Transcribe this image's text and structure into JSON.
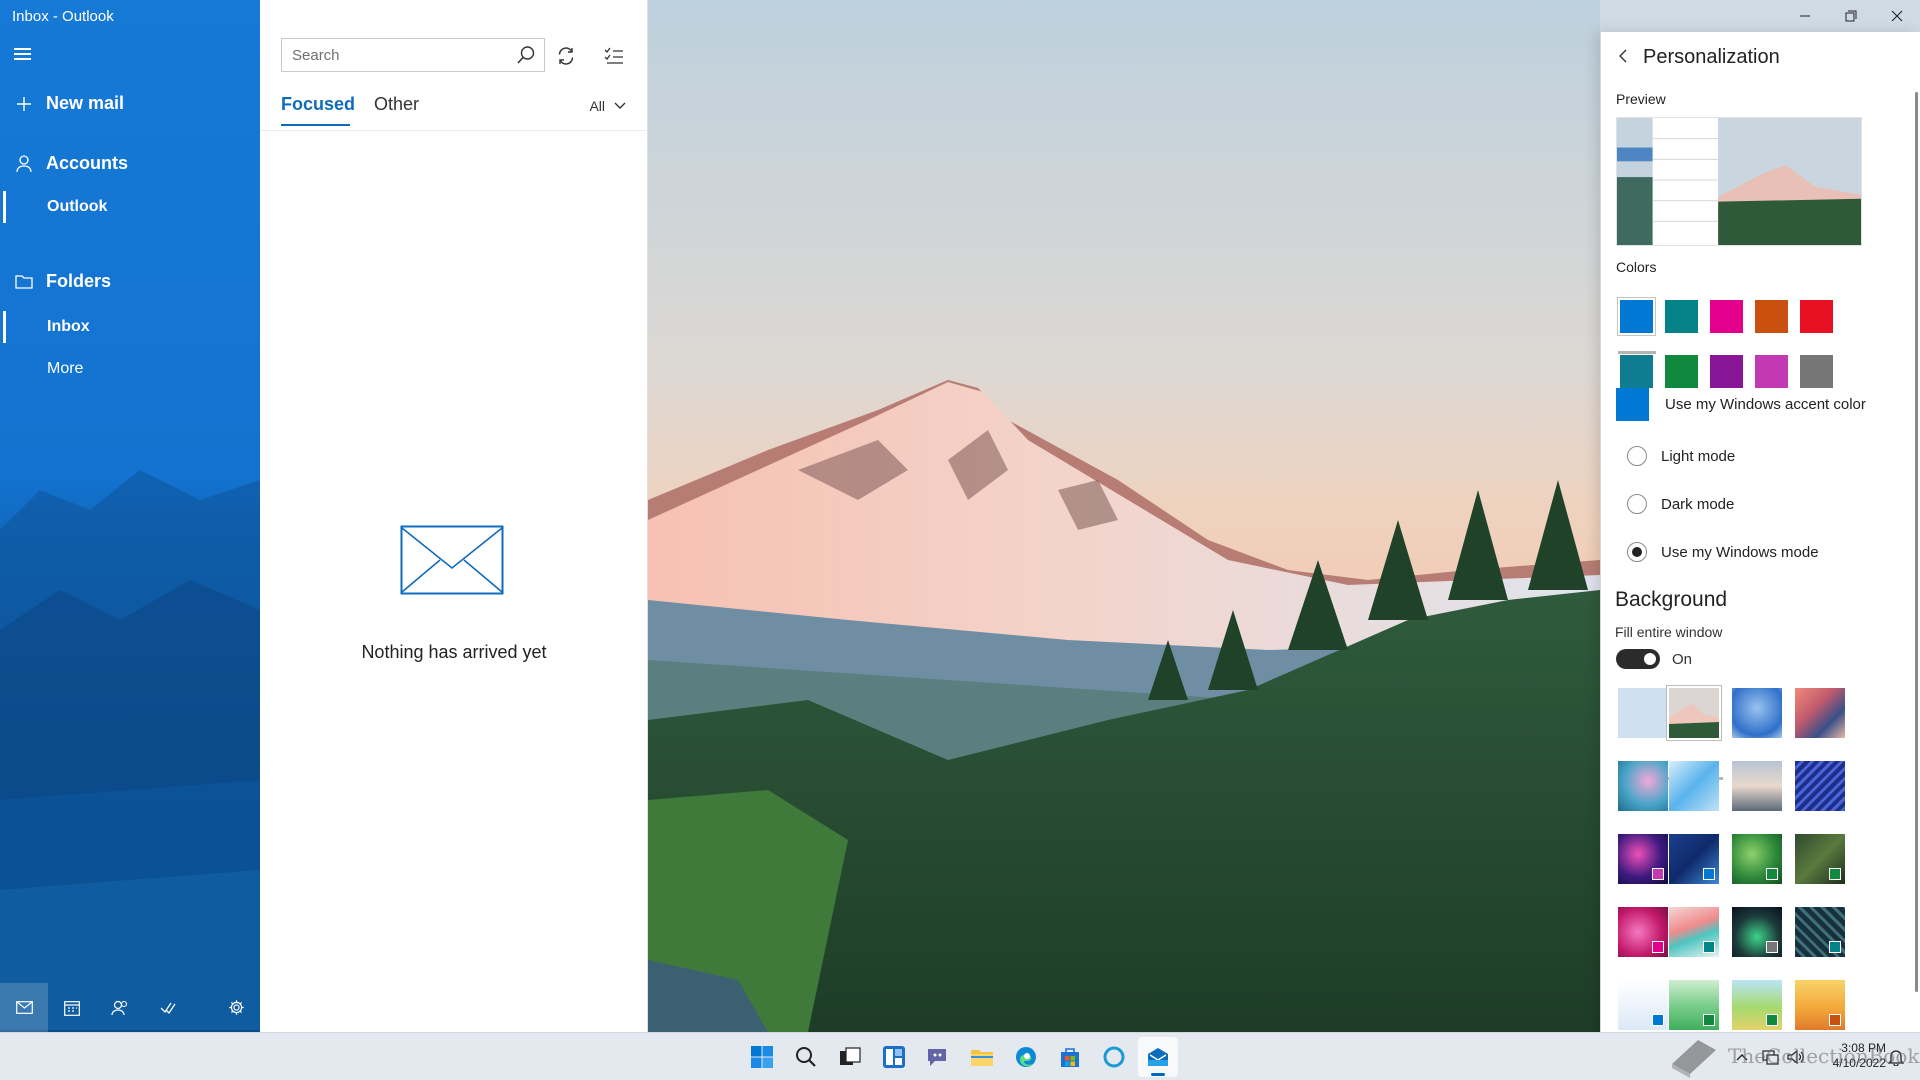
{
  "window": {
    "title": "Inbox - Outlook"
  },
  "nav": {
    "new_mail": "New mail",
    "accounts": "Accounts",
    "account_name": "Outlook",
    "folders": "Folders",
    "inbox": "Inbox",
    "more": "More",
    "bottom_icons": [
      "mail-icon",
      "calendar-icon",
      "people-icon",
      "todo-icon",
      "settings-icon"
    ]
  },
  "list": {
    "search_placeholder": "Search",
    "tabs": {
      "focused": "Focused",
      "other": "Other"
    },
    "filter": "All",
    "empty_message": "Nothing has arrived yet"
  },
  "personalization": {
    "title": "Personalization",
    "preview_label": "Preview",
    "colors_label": "Colors",
    "colors_row1": [
      "#0078d4",
      "#038387",
      "#e3008c",
      "#ca5010",
      "#e81123"
    ],
    "colors_row2": [
      "#0f7d91",
      "#10893e",
      "#881798",
      "#c239b3",
      "#767676"
    ],
    "selected_color": "#0078d4",
    "accent_option": "Use my Windows accent color",
    "modes": [
      "Light mode",
      "Dark mode",
      "Use my Windows mode"
    ],
    "selected_mode": "Use my Windows mode",
    "background_heading": "Background",
    "fill_label": "Fill entire window",
    "fill_state": "On",
    "selected_background": 1
  },
  "taskbar": {
    "apps": [
      "start-icon",
      "search-icon",
      "task-view-icon",
      "widgets-icon",
      "teams-chat-icon",
      "file-explorer-icon",
      "edge-icon",
      "store-icon",
      "cortana-icon",
      "mail-icon"
    ],
    "time": "3:08 PM",
    "date": "4/10/2022",
    "watermark": "TheCollectionBook"
  }
}
